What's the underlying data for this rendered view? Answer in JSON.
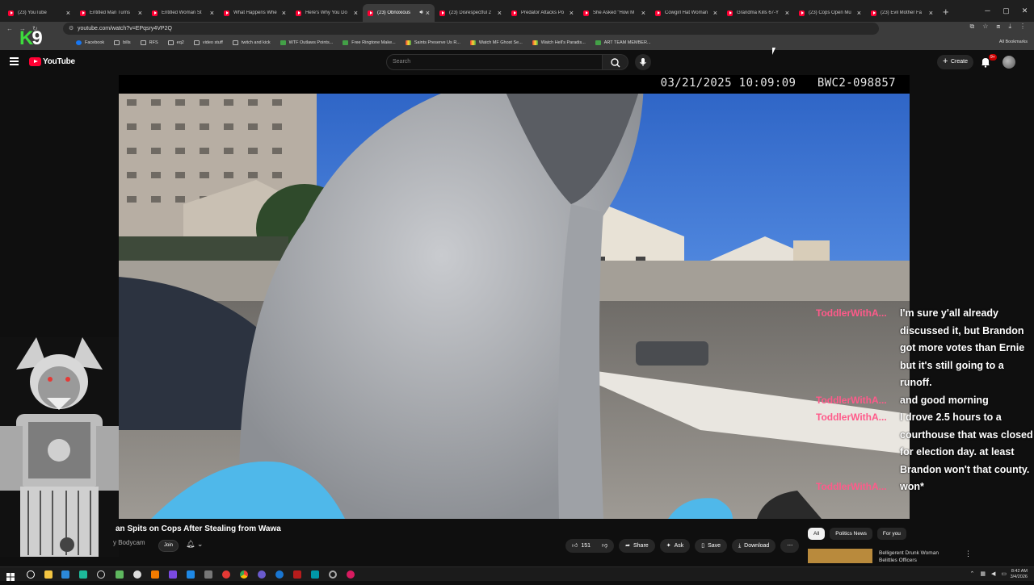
{
  "browser": {
    "tabs": [
      {
        "label": "(23) YouTube",
        "active": false
      },
      {
        "label": "Entitled Man Turns",
        "active": false
      },
      {
        "label": "Entitled Woman St",
        "active": false
      },
      {
        "label": "What Happens Whe",
        "active": false
      },
      {
        "label": "Here's Why You Do",
        "active": false
      },
      {
        "label": "(23) Obnoxious",
        "active": true
      },
      {
        "label": "(23) Disrespectful 2",
        "active": false
      },
      {
        "label": "Predator Attacks Po",
        "active": false
      },
      {
        "label": "She Asked \"How M",
        "active": false
      },
      {
        "label": "Cowgirl Hat Woman",
        "active": false
      },
      {
        "label": "Grandma Kills 67-Y",
        "active": false
      },
      {
        "label": "(23) Cops Open Mu",
        "active": false
      },
      {
        "label": "(23) Evil Mother Fa",
        "active": false
      }
    ],
    "url": "youtube.com/watch?v=EPqsry4VP2Q",
    "bookmarks": [
      {
        "label": "Facebook",
        "icon": "facebook-icon"
      },
      {
        "label": "bills",
        "icon": "folder-icon"
      },
      {
        "label": "RFS",
        "icon": "folder-icon"
      },
      {
        "label": "eq2",
        "icon": "folder-icon"
      },
      {
        "label": "video stuff",
        "icon": "folder-icon"
      },
      {
        "label": "twitch and kick",
        "icon": "folder-icon"
      },
      {
        "label": "WTF Outlaws Points...",
        "icon": "site-icon"
      },
      {
        "label": "Free Ringtone Make...",
        "icon": "site-icon"
      },
      {
        "label": "Saints Preserve Us R...",
        "icon": "globe-icon"
      },
      {
        "label": "Watch MF Ghost Se...",
        "icon": "globe-icon"
      },
      {
        "label": "Watch Hell's Paradis...",
        "icon": "globe-icon"
      },
      {
        "label": "ART TEAM MEMBER...",
        "icon": "site-icon"
      }
    ],
    "all_bookmarks": "All Bookmarks"
  },
  "overlay": {
    "logo_k": "K",
    "logo_9": "9"
  },
  "youtube": {
    "logo_text": "YouTube",
    "search_placeholder": "Search",
    "create_label": "Create",
    "notification_badge": "9+"
  },
  "video": {
    "timestamp": "03/21/2025 10:09:09",
    "device_id": "BWC2-098857"
  },
  "chat": [
    {
      "user": "ToddlerWithA...",
      "message": "I'm sure y'all already discussed it, but Brandon got more votes than Ernie but it's still going to a runoff."
    },
    {
      "user": "ToddlerWithA...",
      "message": "and good morning"
    },
    {
      "user": "ToddlerWithA...",
      "message": "I drove 2.5 hours to a courthouse that was closed for election day. at least Brandon won't that county."
    },
    {
      "user": "ToddlerWithA...",
      "message": "won*"
    }
  ],
  "below": {
    "title": "an Spits on Cops After Stealing from Wawa",
    "channel": "y Bodycam",
    "join_label": "Join",
    "likes": "151",
    "share_label": "Share",
    "ask_label": "Ask",
    "save_label": "Save",
    "download_label": "Download",
    "chips": [
      "All",
      "Politics News",
      "For you"
    ],
    "rec_title": "Belligerent Drunk Woman Belittles Officers"
  },
  "taskbar": {
    "time": "8:42 AM",
    "date": "3/4/2026"
  },
  "colors": {
    "accent": "#ff0033",
    "chat_user": "#ff5a8a",
    "background": "#0f0f0f"
  }
}
